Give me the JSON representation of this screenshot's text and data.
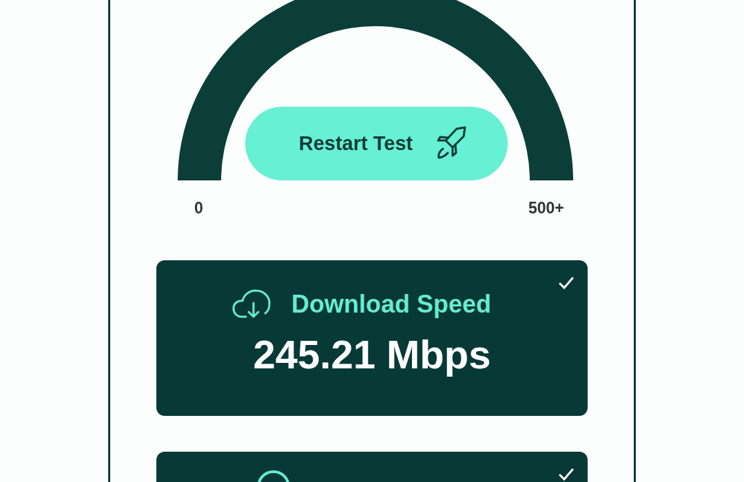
{
  "gauge": {
    "min_label": "0",
    "max_label": "500+"
  },
  "restart_button": {
    "label": "Restart Test"
  },
  "results": [
    {
      "kind": "download",
      "label": "Download Speed",
      "value": "245.21 Mbps",
      "checked": true
    },
    {
      "kind": "cut",
      "checked": true
    }
  ]
}
